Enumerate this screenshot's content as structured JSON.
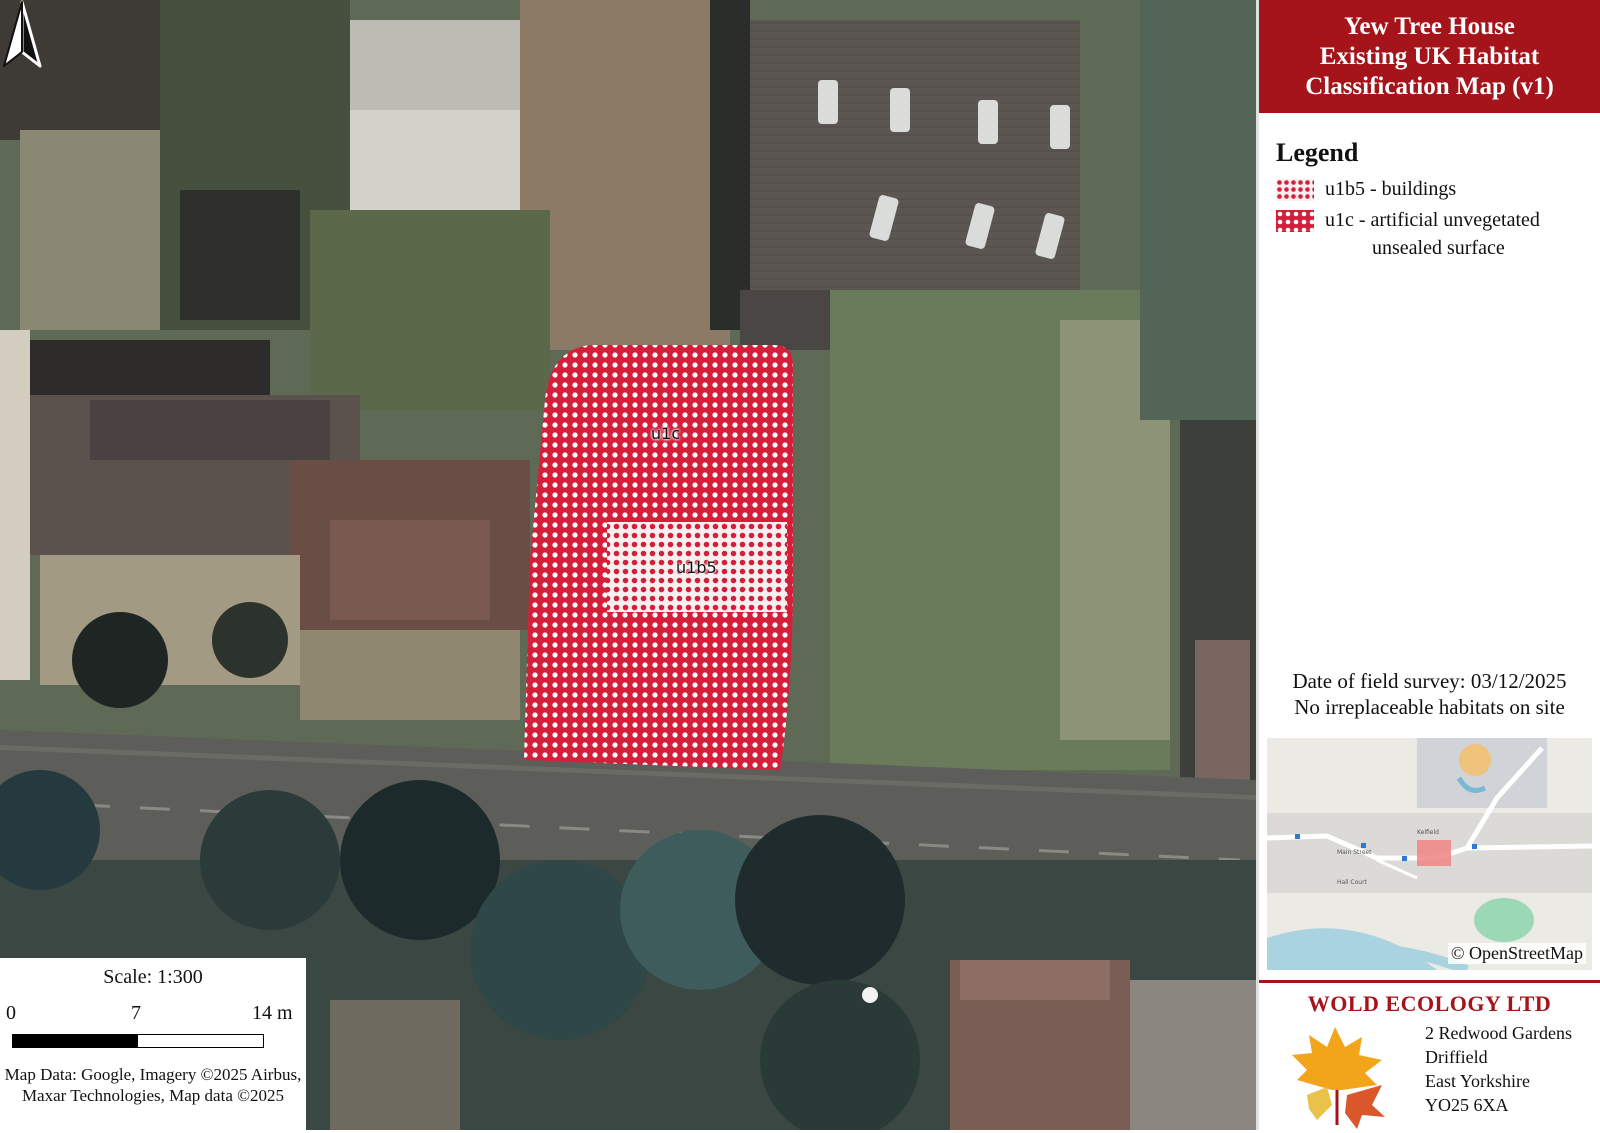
{
  "map": {
    "labels": {
      "u1c": "u1c",
      "u1b5": "u1b5"
    },
    "colors": {
      "habitat_red": "#d41f3b",
      "dots": "#ffffff"
    }
  },
  "north_arrow": {
    "icon": "north-arrow-icon"
  },
  "scale": {
    "title": "Scale: 1:300",
    "ticks": [
      "0",
      "7",
      "14 m"
    ],
    "attribution": "Map Data: Google, Imagery ©2025 Airbus, Maxar Technologies, Map data ©2025"
  },
  "panel": {
    "title_lines": [
      "Yew Tree House",
      "Existing UK Habitat",
      "Classification Map (v1)"
    ],
    "title_bg": "#a5141a",
    "legend": {
      "title": "Legend",
      "items": [
        {
          "code_label": "u1b5 - buildings",
          "label2": ""
        },
        {
          "code_label": "u1c - artificial unvegetated",
          "label2": "unsealed surface"
        }
      ]
    },
    "survey": {
      "date_text": "Date of field survey: 03/12/2025",
      "note": "No irreplaceable habitats on site"
    },
    "inset": {
      "credit": "© OpenStreetMap",
      "streets": [
        "Main Street",
        "Kelfield",
        "Hall Court"
      ]
    },
    "company": {
      "name": "WOLD ECOLOGY LTD",
      "address": [
        "2 Redwood Gardens",
        "Driffield",
        "East Yorkshire",
        "YO25 6XA"
      ],
      "logo_icon": "autumn-leaf-logo-icon"
    }
  }
}
